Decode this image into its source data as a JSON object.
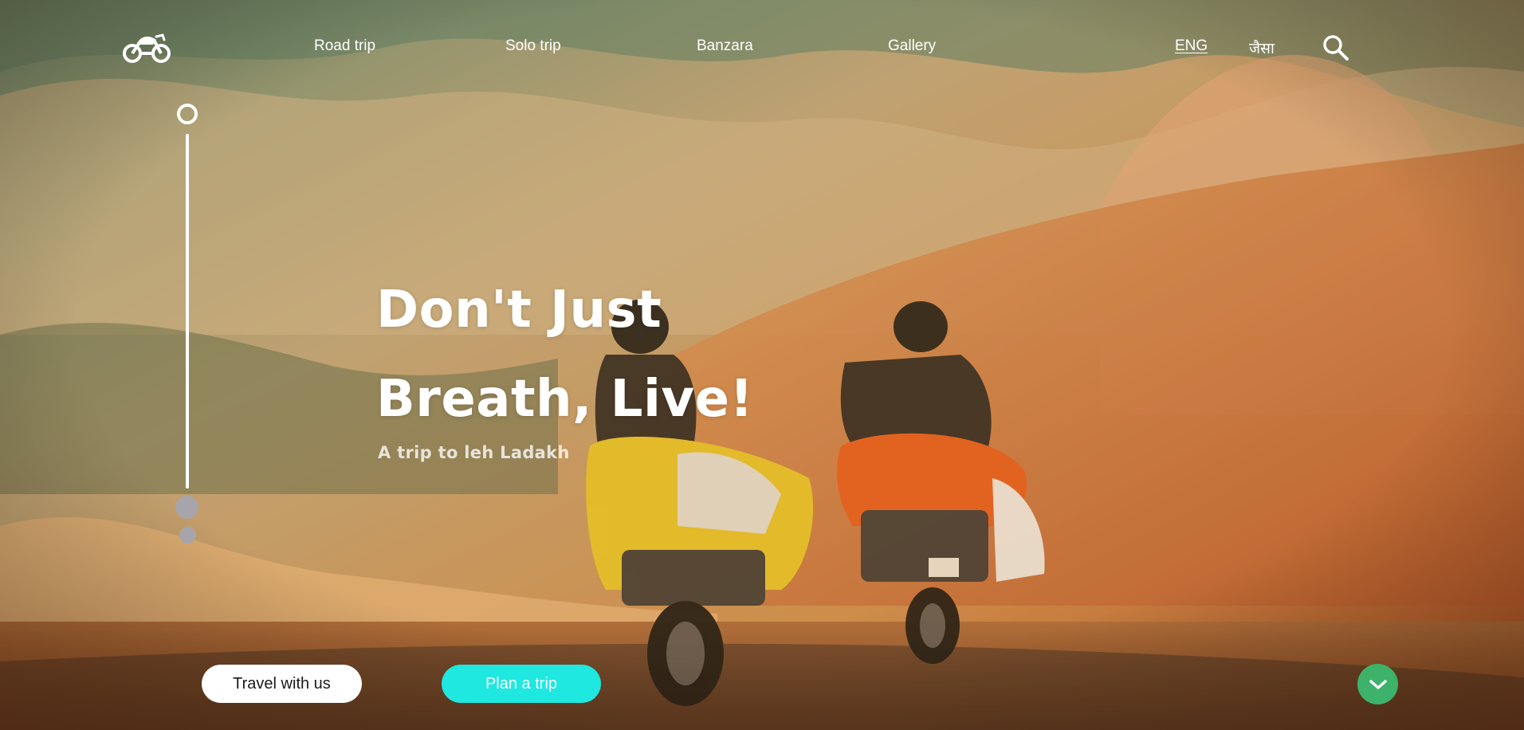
{
  "nav": {
    "logo_icon": "motorcycle-icon",
    "links": [
      {
        "label": "Road trip"
      },
      {
        "label": "Solo trip"
      },
      {
        "label": "Banzara"
      },
      {
        "label": "Gallery"
      }
    ],
    "languages": [
      {
        "label": "ENG",
        "active": true
      },
      {
        "label": "जैसा",
        "active": false
      }
    ],
    "search_icon": "search-icon"
  },
  "hero": {
    "headline_line1": "Don't Just",
    "headline_line2": "Breath, Live!",
    "subtitle": "A trip to leh Ladakh"
  },
  "slider": {
    "slide_count": 3,
    "active_index": 0
  },
  "actions": {
    "travel_label": "Travel with us",
    "plan_label": "Plan a trip",
    "scroll_down_icon": "chevron-down-icon"
  },
  "colors": {
    "plan_button": "#1ee8e0",
    "scroll_button": "#3db26b",
    "inactive_dot": "#a7a5ab"
  }
}
